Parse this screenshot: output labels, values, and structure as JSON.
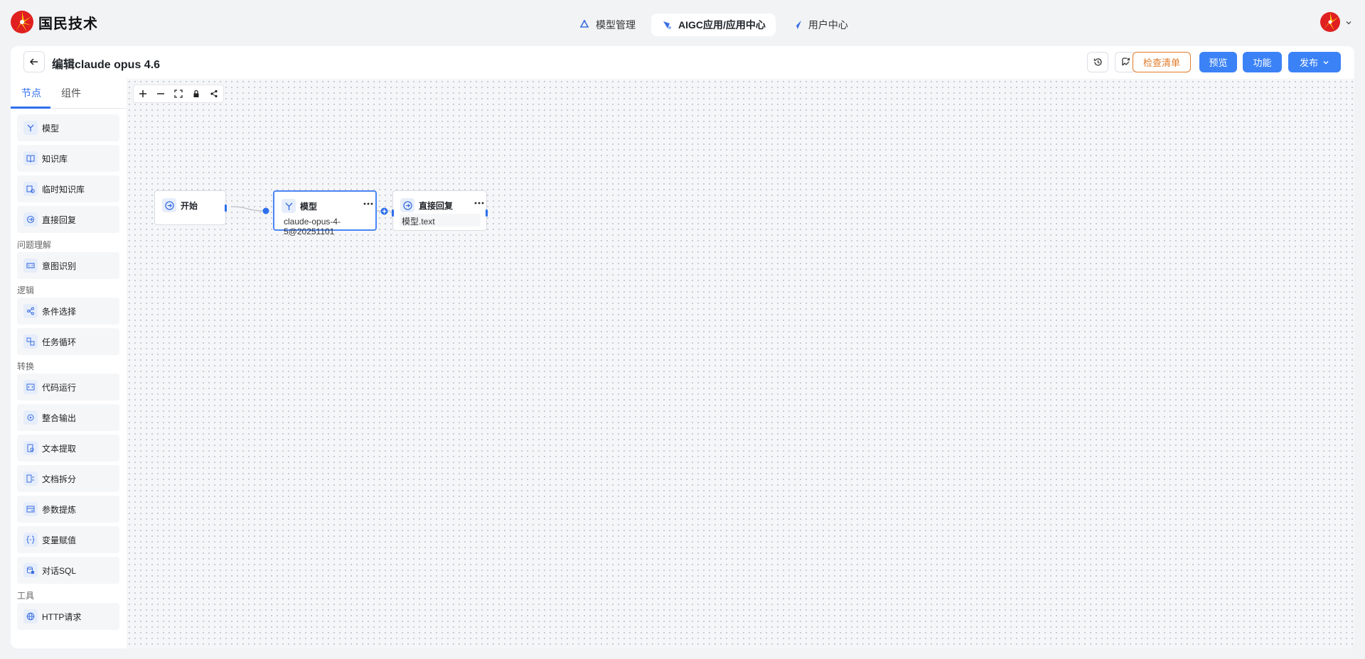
{
  "brand": {
    "name": "国民技术"
  },
  "topnav": [
    {
      "label": "模型管理",
      "icon": "model-icon"
    },
    {
      "label": "AIGC应用/应用中心",
      "icon": "aigc-icon"
    },
    {
      "label": "用户中心",
      "icon": "user-center-icon"
    }
  ],
  "header": {
    "title": "编辑claude opus 4.6",
    "check_label": "检查清单",
    "preview_label": "预览",
    "function_label": "功能",
    "publish_label": "发布"
  },
  "sidebar": {
    "tabs": [
      "节点",
      "组件"
    ],
    "active_tab": "节点",
    "items_basic": [
      "模型",
      "知识库",
      "临时知识库",
      "直接回复"
    ],
    "group_understanding": "问题理解",
    "items_understanding": [
      "意图识别"
    ],
    "group_logic": "逻辑",
    "items_logic": [
      "条件选择",
      "任务循环"
    ],
    "group_transform": "转换",
    "items_transform": [
      "代码运行",
      "整合输出",
      "文本提取",
      "文档拆分",
      "参数提炼",
      "变量赋值",
      "对话SQL"
    ],
    "group_tools": "工具",
    "items_tools": [
      "HTTP请求"
    ]
  },
  "canvas": {
    "nodes": {
      "start": {
        "title": "开始"
      },
      "model": {
        "title": "模型",
        "value": "claude-opus-4-5@20251101"
      },
      "reply": {
        "title": "直接回复",
        "value": "模型.text"
      }
    }
  },
  "colors": {
    "primary": "#3b82f6",
    "outline": "#e07b2a",
    "accent": "#2f6fed"
  }
}
